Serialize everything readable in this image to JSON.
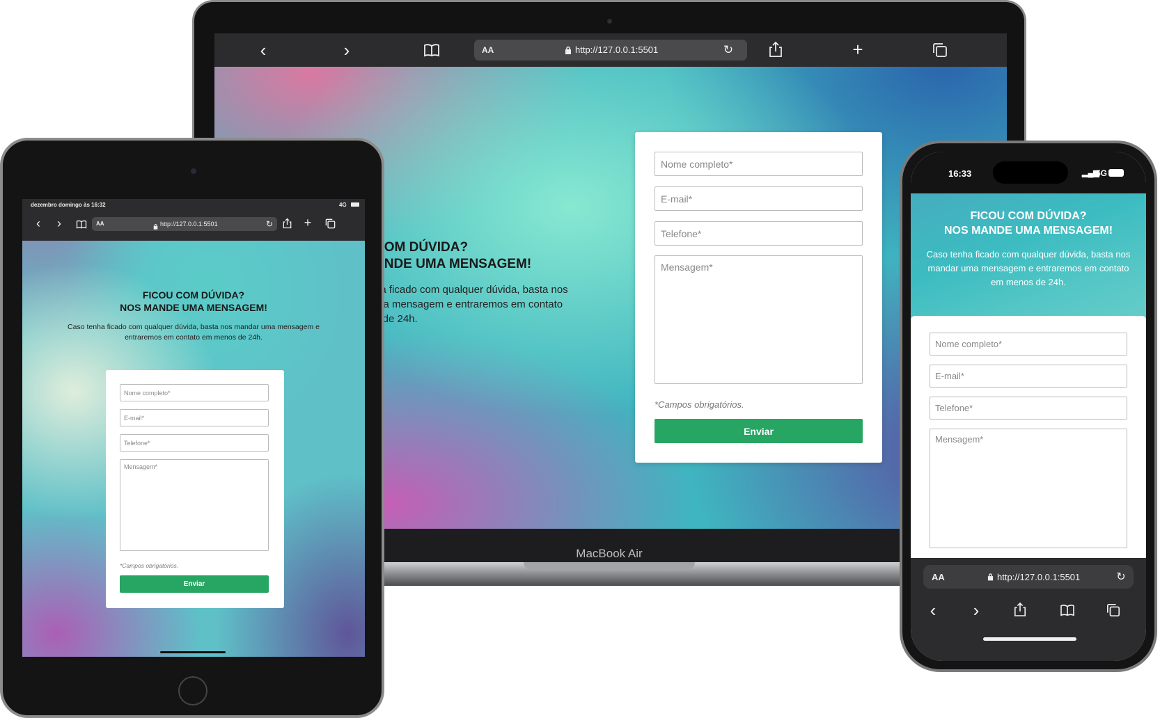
{
  "url": "http://127.0.0.1:5501",
  "reader_label": "AA",
  "laptop": {
    "brand": "MacBook Air",
    "heading_line1": "COM DÚVIDA?",
    "heading_line2": "ANDE UMA MENSAGEM!",
    "desc_line1": "na ficado com qualquer dúvida, basta nos",
    "desc_line2": "ma mensagem e entraremos em contato",
    "desc_line3": "s de 24h."
  },
  "tablet": {
    "status_time": "dezembro domingo às 16:32",
    "status_network": "4G",
    "heading_line1": "FICOU COM DÚVIDA?",
    "heading_line2": "NOS MANDE UMA MENSAGEM!",
    "desc_line1": "Caso tenha ficado com qualquer dúvida, basta nos mandar uma mensagem e",
    "desc_line2": "entraremos em contato em menos de 24h."
  },
  "phone": {
    "status_time": "16:33",
    "status_network": "5G",
    "heading_line1": "FICOU COM DÚVIDA?",
    "heading_line2": "NOS MANDE UMA MENSAGEM!",
    "desc_line1": "Caso tenha ficado com qualquer dúvida, basta nos",
    "desc_line2": "mandar uma mensagem e entraremos em contato",
    "desc_line3": "em menos de 24h."
  },
  "form": {
    "name_placeholder": "Nome completo*",
    "email_placeholder": "E-mail*",
    "phone_placeholder": "Telefone*",
    "message_placeholder": "Mensagem*",
    "required_note": "*Campos obrigatórios.",
    "submit_label": "Enviar"
  },
  "colors": {
    "accent_green": "#27a563",
    "toolbar_dark": "#2c2c2e",
    "device_frame": "#1a1a1a"
  }
}
